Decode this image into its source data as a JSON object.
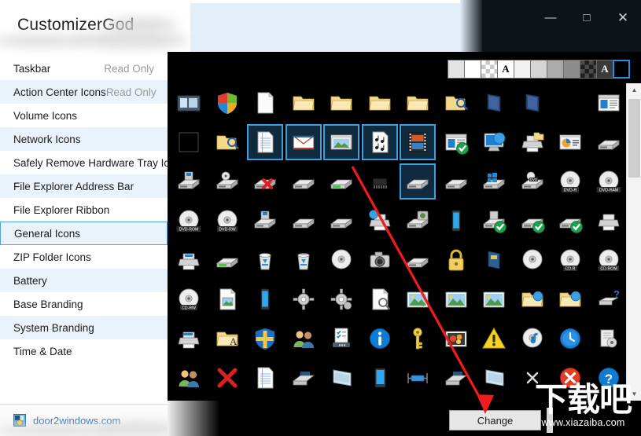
{
  "window": {
    "title": "CustomizerGod",
    "controls": [
      {
        "name": "minimize",
        "glyph": "—"
      },
      {
        "name": "maximize",
        "glyph": "□"
      },
      {
        "name": "close",
        "glyph": "✕"
      }
    ],
    "titlebar_color": "#0c1419",
    "accent_color": "#2a8ee0"
  },
  "sidebar": {
    "items": [
      {
        "label": "Taskbar",
        "status": "Read Only",
        "selected": false
      },
      {
        "label": "Action Center Icons",
        "status": "Read Only",
        "selected": false
      },
      {
        "label": "Volume Icons",
        "status": "",
        "selected": false
      },
      {
        "label": "Network Icons",
        "status": "",
        "selected": false
      },
      {
        "label": "Safely Remove Hardware Tray Icon",
        "status": "",
        "selected": false
      },
      {
        "label": "File Explorer Address Bar",
        "status": "",
        "selected": false
      },
      {
        "label": "File Explorer Ribbon",
        "status": "",
        "selected": false
      },
      {
        "label": "General Icons",
        "status": "",
        "selected": true
      },
      {
        "label": "ZIP Folder Icons",
        "status": "",
        "selected": false
      },
      {
        "label": "Battery",
        "status": "",
        "selected": false
      },
      {
        "label": "Base Branding",
        "status": "",
        "selected": false
      },
      {
        "label": "System Branding",
        "status": "",
        "selected": false
      },
      {
        "label": "Time & Date",
        "status": "",
        "selected": false
      }
    ],
    "selected_label": "General Icons",
    "selection_color": "#4ea3dd",
    "alt_row_color": "#eaf2fb"
  },
  "footer": {
    "link_text": "door2windows.com",
    "link_color": "#2a6fb5",
    "icon": "door2windows-logo-icon"
  },
  "toolbar": {
    "label": "background-swatches",
    "swatches": [
      {
        "name": "swatch-light-gray",
        "kind": "solid",
        "color": "#e3e3e3",
        "letter": "",
        "selected": false
      },
      {
        "name": "swatch-white",
        "kind": "solid",
        "color": "#ffffff",
        "letter": "",
        "selected": false
      },
      {
        "name": "swatch-checker-light",
        "kind": "checker-light",
        "color": "",
        "letter": "",
        "selected": false
      },
      {
        "name": "swatch-white-text",
        "kind": "solid",
        "color": "#ffffff",
        "letter": "A",
        "selected": false
      },
      {
        "name": "swatch-near-white",
        "kind": "solid",
        "color": "#f2f2f2",
        "letter": "",
        "selected": false
      },
      {
        "name": "swatch-pale-gray",
        "kind": "solid",
        "color": "#d5d5d5",
        "letter": "",
        "selected": false
      },
      {
        "name": "swatch-mid-gray",
        "kind": "solid",
        "color": "#aaaaaa",
        "letter": "",
        "selected": false
      },
      {
        "name": "swatch-dark-gray",
        "kind": "solid",
        "color": "#8d8d8d",
        "letter": "",
        "selected": false
      },
      {
        "name": "swatch-checker-dark",
        "kind": "checker-dark",
        "color": "",
        "letter": "",
        "selected": false
      },
      {
        "name": "swatch-black-text",
        "kind": "solid",
        "color": "#3a3a3a",
        "letter": "A",
        "selected": false
      },
      {
        "name": "swatch-black",
        "kind": "solid",
        "color": "#000000",
        "letter": "",
        "selected": true
      }
    ]
  },
  "grid": {
    "background": "#000000",
    "selection_border": "#3aa0e0",
    "selection_fill": "#112b3e",
    "columns": 12,
    "icons": [
      {
        "name": "remote-desktop-icon",
        "selected": false
      },
      {
        "name": "windows-shield-color-icon",
        "selected": false
      },
      {
        "name": "blank-document-icon",
        "selected": false
      },
      {
        "name": "folder-closed-icon",
        "selected": false
      },
      {
        "name": "folder-open-icon",
        "selected": false
      },
      {
        "name": "folder-icon",
        "selected": false
      },
      {
        "name": "folder-thin-icon",
        "selected": false
      },
      {
        "name": "search-folder-icon",
        "selected": false
      },
      {
        "name": "folder-dark-open-icon",
        "selected": false
      },
      {
        "name": "folder-dark-icon",
        "selected": false
      },
      {
        "name": "empty-slot",
        "selected": false
      },
      {
        "name": "window-pane-icon",
        "selected": false
      },
      {
        "name": "empty-square-icon",
        "selected": false
      },
      {
        "name": "folder-search-icon",
        "selected": false
      },
      {
        "name": "text-document-icon",
        "selected": true
      },
      {
        "name": "mail-envelope-icon",
        "selected": true
      },
      {
        "name": "image-preview-icon",
        "selected": true
      },
      {
        "name": "music-sheet-icon",
        "selected": true
      },
      {
        "name": "film-strip-icon",
        "selected": true
      },
      {
        "name": "window-check-icon",
        "selected": false
      },
      {
        "name": "network-globe-icon",
        "selected": false
      },
      {
        "name": "printer-folder-icon",
        "selected": false
      },
      {
        "name": "presentation-chart-icon",
        "selected": false
      },
      {
        "name": "tape-drive-icon",
        "selected": false
      },
      {
        "name": "floppy-drive-icon",
        "selected": false
      },
      {
        "name": "disc-drive-icon",
        "selected": false
      },
      {
        "name": "drive-error-icon",
        "selected": false
      },
      {
        "name": "hard-drive-icon",
        "selected": false
      },
      {
        "name": "drive-green-icon",
        "selected": false
      },
      {
        "name": "memory-chip-icon",
        "selected": false
      },
      {
        "name": "hard-drive-selected-icon",
        "selected": true
      },
      {
        "name": "drive-stack-icon",
        "selected": false
      },
      {
        "name": "windows-drive-icon",
        "selected": false
      },
      {
        "name": "dvd-drive-icon",
        "selected": false
      },
      {
        "name": "dvd-r-disc-icon",
        "selected": false
      },
      {
        "name": "dvd-ram-disc-icon",
        "selected": false
      },
      {
        "name": "dvd-rom-disc-icon",
        "selected": false
      },
      {
        "name": "dvd-rw-disc-icon",
        "selected": false
      },
      {
        "name": "zip-drive-icon",
        "selected": false
      },
      {
        "name": "tape-cartridge-icon",
        "selected": false
      },
      {
        "name": "removable-drive-icon",
        "selected": false
      },
      {
        "name": "network-printer-icon",
        "selected": false
      },
      {
        "name": "camera-drive-icon",
        "selected": false
      },
      {
        "name": "phone-device-icon",
        "selected": false
      },
      {
        "name": "floppy-check-icon",
        "selected": false
      },
      {
        "name": "drive-check-icon",
        "selected": false
      },
      {
        "name": "drive-green-check-icon",
        "selected": false
      },
      {
        "name": "printer-plain-icon",
        "selected": false
      },
      {
        "name": "printer-blue-icon",
        "selected": false
      },
      {
        "name": "printer-green-icon",
        "selected": false
      },
      {
        "name": "recycle-bin-empty-icon",
        "selected": false
      },
      {
        "name": "recycle-bin-full-icon",
        "selected": false
      },
      {
        "name": "dvd-disc-icon",
        "selected": false
      },
      {
        "name": "camera-icon",
        "selected": false
      },
      {
        "name": "card-drive-icon",
        "selected": false
      },
      {
        "name": "lock-icon",
        "selected": false
      },
      {
        "name": "memory-card-icon",
        "selected": false
      },
      {
        "name": "cd-blank-disc-icon",
        "selected": false
      },
      {
        "name": "cd-r-disc-icon",
        "selected": false
      },
      {
        "name": "cd-rom-disc-icon",
        "selected": false
      },
      {
        "name": "cd-rw-disc-icon",
        "selected": false
      },
      {
        "name": "document-photo-icon",
        "selected": false
      },
      {
        "name": "phone-blue-icon",
        "selected": false
      },
      {
        "name": "gear-icon",
        "selected": false
      },
      {
        "name": "gears-icon",
        "selected": false
      },
      {
        "name": "document-search-icon",
        "selected": false
      },
      {
        "name": "picture-landscape-icon",
        "selected": false
      },
      {
        "name": "picture-frame-icon",
        "selected": false
      },
      {
        "name": "photo-wide-icon",
        "selected": false
      },
      {
        "name": "network-folder-icon",
        "selected": false
      },
      {
        "name": "network-folder-2-icon",
        "selected": false
      },
      {
        "name": "usb-unknown-icon",
        "selected": false
      },
      {
        "name": "printer-network-icon",
        "selected": false
      },
      {
        "name": "folder-font-icon",
        "selected": false
      },
      {
        "name": "shield-blue-icon",
        "selected": false
      },
      {
        "name": "users-group-icon",
        "selected": false
      },
      {
        "name": "checklist-icon",
        "selected": false
      },
      {
        "name": "info-icon",
        "selected": false
      },
      {
        "name": "key-icon",
        "selected": false
      },
      {
        "name": "flower-picture-icon",
        "selected": false
      },
      {
        "name": "warning-icon",
        "selected": false
      },
      {
        "name": "audio-cd-icon",
        "selected": false
      },
      {
        "name": "clock-icon",
        "selected": false
      },
      {
        "name": "backup-icon",
        "selected": false
      },
      {
        "name": "users-pair-icon",
        "selected": false
      },
      {
        "name": "error-x-icon",
        "selected": false
      },
      {
        "name": "document-text-icon",
        "selected": false
      },
      {
        "name": "scanner-icon",
        "selected": false
      },
      {
        "name": "display-panel-icon",
        "selected": false
      },
      {
        "name": "monitor-blue-icon",
        "selected": false
      },
      {
        "name": "network-link-icon",
        "selected": false
      },
      {
        "name": "scanner-flat-icon",
        "selected": false
      },
      {
        "name": "display-tilt-icon",
        "selected": false
      },
      {
        "name": "close-small-icon",
        "selected": false
      },
      {
        "name": "error-circle-icon",
        "selected": false
      },
      {
        "name": "help-question-icon",
        "selected": false
      },
      {
        "name": "window-teal-icon",
        "selected": false
      }
    ]
  },
  "scrollbar": {
    "up_glyph": "▲",
    "down_glyph": "▼",
    "thumb_top_pct": 5,
    "thumb_height_pct": 25
  },
  "bottom": {
    "change_label": "Change"
  },
  "watermark": {
    "text_cn": "下载吧",
    "url": "www.xiazaiba.com"
  },
  "annotation": {
    "type": "red-arrow",
    "color": "#ee1c1c"
  }
}
